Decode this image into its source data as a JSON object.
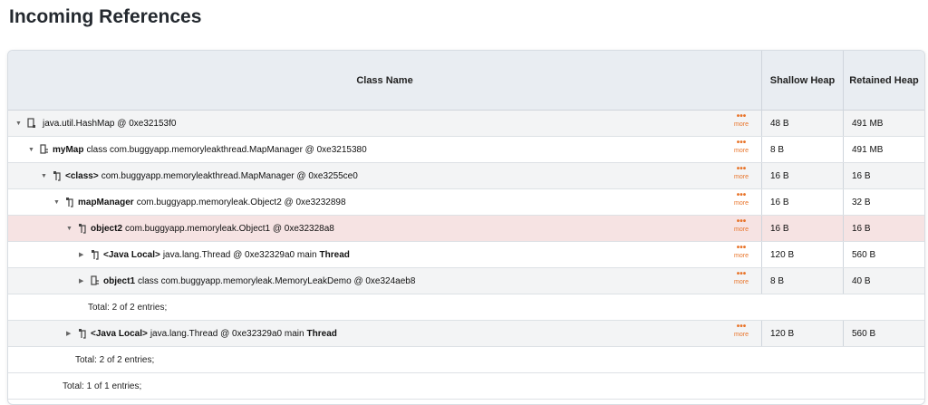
{
  "title": "Incoming References",
  "columns": {
    "class_name": "Class Name",
    "shallow_heap": "Shallow Heap",
    "retained_heap": "Retained Heap"
  },
  "more_label": "more",
  "rows": [
    {
      "field": "",
      "name": "java.util.HashMap @ 0xe32153f0",
      "suffix": "",
      "shallow": "48 B",
      "retained": "491 MB"
    },
    {
      "field": "myMap",
      "name": "class com.buggyapp.memoryleakthread.MapManager @ 0xe3215380",
      "suffix": "",
      "shallow": "8 B",
      "retained": "491 MB"
    },
    {
      "field": "<class>",
      "name": "com.buggyapp.memoryleakthread.MapManager @ 0xe3255ce0",
      "suffix": "",
      "shallow": "16 B",
      "retained": "16 B"
    },
    {
      "field": "mapManager",
      "name": "com.buggyapp.memoryleak.Object2 @ 0xe3232898",
      "suffix": "",
      "shallow": "16 B",
      "retained": "32 B"
    },
    {
      "field": "object2",
      "name": "com.buggyapp.memoryleak.Object1 @ 0xe32328a8",
      "suffix": "",
      "shallow": "16 B",
      "retained": "16 B"
    },
    {
      "field": "<Java Local>",
      "name": "java.lang.Thread @ 0xe32329a0 main",
      "suffix": "Thread",
      "shallow": "120 B",
      "retained": "560 B"
    },
    {
      "field": "object1",
      "name": "class com.buggyapp.memoryleak.MemoryLeakDemo @ 0xe324aeb8",
      "suffix": "",
      "shallow": "8 B",
      "retained": "40 B"
    },
    {
      "field": "<Java Local>",
      "name": "java.lang.Thread @ 0xe32329a0 main",
      "suffix": "Thread",
      "shallow": "120 B",
      "retained": "560 B"
    }
  ],
  "totals": [
    "Total: 2 of 2 entries;",
    "Total: 2 of 2 entries;",
    "Total: 1 of 1 entries;"
  ],
  "colors": {
    "more": "#e8742a",
    "selected_row": "#f6e3e3",
    "header_bg": "#e9edf2"
  }
}
